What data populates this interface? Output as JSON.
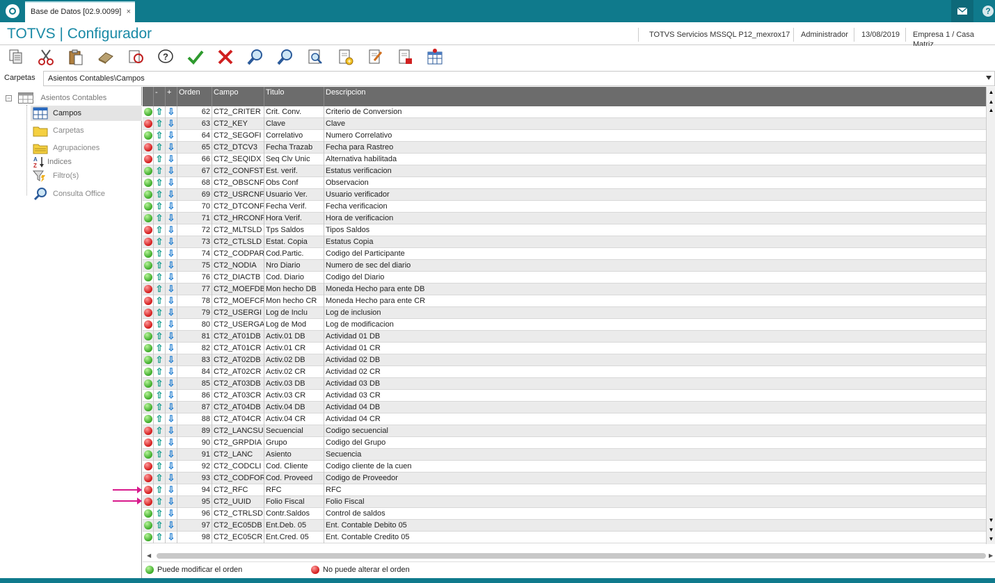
{
  "window": {
    "tab_title": "Base de Datos [02.9.0099]",
    "close_glyph": "×"
  },
  "header": {
    "app_title": "TOTVS | Configurador",
    "environment": "TOTVS Servicios MSSQL P12_mexrox17",
    "user": "Administrador",
    "date": "13/08/2019",
    "company": "Empresa 1 / Casa Matriz"
  },
  "folder_bar": {
    "label": "Carpetas",
    "path": "Asientos Contables\\Campos"
  },
  "tree": {
    "root": "Asientos Contables",
    "items": [
      {
        "label": "Campos",
        "icon": "table-icon",
        "selected": true
      },
      {
        "label": "Carpetas",
        "icon": "folder-icon"
      },
      {
        "label": "Agrupaciones",
        "icon": "folder-stack-icon"
      },
      {
        "label": "Indices",
        "icon": "sort-az-icon"
      },
      {
        "label": "Filtro(s)",
        "icon": "filter-icon"
      },
      {
        "label": "Consulta Office",
        "icon": "magnifier-icon"
      }
    ]
  },
  "grid": {
    "columns": [
      "",
      "-",
      "+",
      "Orden",
      "Campo",
      "Titulo",
      "Descripcion"
    ],
    "rows": [
      {
        "s": "g",
        "o": "62",
        "c": "CT2_CRITER",
        "t": "Crit. Conv.",
        "d": "Criterio de Conversion"
      },
      {
        "s": "r",
        "o": "63",
        "c": "CT2_KEY",
        "t": "Clave",
        "d": "Clave"
      },
      {
        "s": "g",
        "o": "64",
        "c": "CT2_SEGOFI",
        "t": "Correlativo",
        "d": "Numero Correlativo"
      },
      {
        "s": "r",
        "o": "65",
        "c": "CT2_DTCV3",
        "t": "Fecha Trazab",
        "d": "Fecha para Rastreo"
      },
      {
        "s": "r",
        "o": "66",
        "c": "CT2_SEQIDX",
        "t": "Seq Clv Unic",
        "d": "Alternativa habilitada"
      },
      {
        "s": "g",
        "o": "67",
        "c": "CT2_CONFST",
        "t": "Est. verif.",
        "d": "Estatus verificacion"
      },
      {
        "s": "g",
        "o": "68",
        "c": "CT2_OBSCNF",
        "t": "Obs Conf",
        "d": "Observacion"
      },
      {
        "s": "g",
        "o": "69",
        "c": "CT2_USRCNF",
        "t": "Usuario Ver.",
        "d": "Usuario verificador"
      },
      {
        "s": "g",
        "o": "70",
        "c": "CT2_DTCONF",
        "t": "Fecha Verif.",
        "d": "Fecha verificacion"
      },
      {
        "s": "g",
        "o": "71",
        "c": "CT2_HRCONF",
        "t": "Hora Verif.",
        "d": "Hora de verificacion"
      },
      {
        "s": "r",
        "o": "72",
        "c": "CT2_MLTSLD",
        "t": "Tps Saldos",
        "d": "Tipos Saldos"
      },
      {
        "s": "r",
        "o": "73",
        "c": "CT2_CTLSLD",
        "t": "Estat. Copia",
        "d": "Estatus Copia"
      },
      {
        "s": "g",
        "o": "74",
        "c": "CT2_CODPAR",
        "t": "Cod.Partic.",
        "d": "Codigo del Participante"
      },
      {
        "s": "g",
        "o": "75",
        "c": "CT2_NODIA",
        "t": "Nro Diario",
        "d": "Numero de sec del diario"
      },
      {
        "s": "g",
        "o": "76",
        "c": "CT2_DIACTB",
        "t": "Cod. Diario",
        "d": "Codigo del Diario"
      },
      {
        "s": "r",
        "o": "77",
        "c": "CT2_MOEFDB",
        "t": "Mon hecho DB",
        "d": "Moneda Hecho para ente DB"
      },
      {
        "s": "r",
        "o": "78",
        "c": "CT2_MOEFCR",
        "t": "Mon hecho CR",
        "d": "Moneda Hecho para ente CR"
      },
      {
        "s": "r",
        "o": "79",
        "c": "CT2_USERGI",
        "t": "Log de Inclu",
        "d": "Log de inclusion"
      },
      {
        "s": "r",
        "o": "80",
        "c": "CT2_USERGA",
        "t": "Log de Mod",
        "d": "Log de modificacion"
      },
      {
        "s": "g",
        "o": "81",
        "c": "CT2_AT01DB",
        "t": "Activ.01 DB",
        "d": "Actividad 01 DB"
      },
      {
        "s": "g",
        "o": "82",
        "c": "CT2_AT01CR",
        "t": "Activ.01 CR",
        "d": "Actividad 01 CR"
      },
      {
        "s": "g",
        "o": "83",
        "c": "CT2_AT02DB",
        "t": "Activ.02 DB",
        "d": "Actividad 02 DB"
      },
      {
        "s": "g",
        "o": "84",
        "c": "CT2_AT02CR",
        "t": "Activ.02 CR",
        "d": "Actividad 02 CR"
      },
      {
        "s": "g",
        "o": "85",
        "c": "CT2_AT03DB",
        "t": "Activ.03 DB",
        "d": "Actividad 03 DB"
      },
      {
        "s": "g",
        "o": "86",
        "c": "CT2_AT03CR",
        "t": "Activ.03 CR",
        "d": "Actividad 03 CR"
      },
      {
        "s": "g",
        "o": "87",
        "c": "CT2_AT04DB",
        "t": "Activ.04 DB",
        "d": "Actividad 04 DB"
      },
      {
        "s": "g",
        "o": "88",
        "c": "CT2_AT04CR",
        "t": "Activ.04 CR",
        "d": "Actividad 04 CR"
      },
      {
        "s": "r",
        "o": "89",
        "c": "CT2_LANCSU",
        "t": "Secuencial",
        "d": "Codigo secuencial"
      },
      {
        "s": "r",
        "o": "90",
        "c": "CT2_GRPDIA",
        "t": "Grupo",
        "d": "Codigo del Grupo"
      },
      {
        "s": "g",
        "o": "91",
        "c": "CT2_LANC",
        "t": "Asiento",
        "d": "Secuencia"
      },
      {
        "s": "r",
        "o": "92",
        "c": "CT2_CODCLI",
        "t": "Cod. Cliente",
        "d": "Codigo cliente de la cuen"
      },
      {
        "s": "r",
        "o": "93",
        "c": "CT2_CODFOR",
        "t": "Cod. Proveed",
        "d": "Codigo de Proveedor"
      },
      {
        "s": "r",
        "o": "94",
        "c": "CT2_RFC",
        "t": "RFC",
        "d": "RFC"
      },
      {
        "s": "r",
        "o": "95",
        "c": "CT2_UUID",
        "t": "Folio Fiscal",
        "d": "Folio Fiscal"
      },
      {
        "s": "g",
        "o": "96",
        "c": "CT2_CTRLSD",
        "t": "Contr.Saldos",
        "d": "Control de saldos"
      },
      {
        "s": "g",
        "o": "97",
        "c": "CT2_EC05DB",
        "t": "Ent.Deb. 05",
        "d": "Ent. Contable Debito 05"
      },
      {
        "s": "g",
        "o": "98",
        "c": "CT2_EC05CR",
        "t": "Ent.Cred. 05",
        "d": "Ent. Contable Credito 05"
      }
    ]
  },
  "legend": {
    "green": "Puede modificar el orden",
    "red": "No puede alterar el orden"
  },
  "colors": {
    "accent": "#0f7a8c",
    "title": "#1a8aa6",
    "status_green": "#3caa28",
    "status_red": "#d21a1a",
    "annotation_arrow": "#d81a8c"
  }
}
